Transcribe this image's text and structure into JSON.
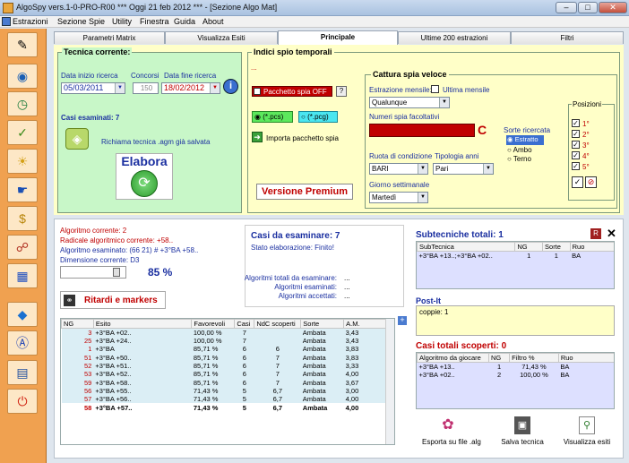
{
  "window": {
    "title": "AlgoSpy vers.1-0-PRO-R00  ***  Oggi 21 feb 2012  ***  - [Sezione Algo Mat]",
    "min": "–",
    "max": "□",
    "close": "✕"
  },
  "menu": [
    "Estrazioni",
    "Sezione Spie",
    "Utility",
    "Finestra",
    "Guida",
    "About"
  ],
  "tabs": [
    "Parametri Matrix",
    "Visualizza Esiti",
    "Principale",
    "Ultime 200 estrazioni",
    "Filtri"
  ],
  "tecnica": {
    "legend": "Tecnica corrente:",
    "data_inizio_label": "Data inizio ricerca",
    "concorsi_label": "Concorsi",
    "data_fine_label": "Data fine ricerca",
    "data_inizio": "05/03/2011",
    "concorsi": "150",
    "data_fine": "18/02/2012",
    "casi_esaminati": "Casi esaminati: 7",
    "richiama": "Richiama tecnica .agm già salvata",
    "elabora": "Elabora"
  },
  "indici": {
    "legend": "Indici spio temporali",
    "dots": "...",
    "pacchetto": "Pacchetto spia OFF",
    "help": "?",
    "pcs": "(*.pcs)",
    "pcg": "(*.pcg)",
    "importa": "Importa pacchetto spia",
    "premium": "Versione Premium"
  },
  "cattura": {
    "legend": "Cattura spia veloce",
    "estrazione_label": "Estrazione mensile:",
    "ultima_label": "Ultima mensile",
    "estrazione_value": "Qualunque",
    "numeri_label": "Numeri spia facoltativi",
    "c_label": "C",
    "sorte_label": "Sorte ricercata",
    "sorte_options": [
      "Estratto",
      "Ambo",
      "Terno"
    ],
    "ruota_label": "Ruota di condizione",
    "ruota_value": "BARI",
    "tipologia_label": "Tipologia anni",
    "tipologia_value": "Pari",
    "giorno_label": "Giorno settimanale",
    "giorno_value": "Martedì",
    "posizioni_label": "Posizioni",
    "posizioni": [
      "1°",
      "2°",
      "3°",
      "4°",
      "5°"
    ]
  },
  "algo": {
    "corrente": "Algoritmo corrente: 2",
    "radicale": "Radicale algoritmico corrente:  +58..",
    "esaminato": "Algoritmo esaminato:  (66 21) # +3°BA +58..",
    "dimensione": "Dimensione corrente:  D3",
    "percent": "85 %",
    "ritardi": "Ritardi e markers"
  },
  "casi": {
    "title": "Casi da esaminare: 7",
    "stato": "Stato elaborazione: Finito!",
    "totali": "Algoritmi totali da esaminare:",
    "esaminati": "Algoritmi esaminati:",
    "accettati": "Algoritmi accettati:",
    "dots": "..."
  },
  "main_table": {
    "headers": [
      "NG",
      "Esito",
      "Favorevoli",
      "Casi",
      "NdC scoperti",
      "Sorte",
      "A.M."
    ],
    "rows": [
      [
        "3",
        "+3°BA +02..",
        "100,00 %",
        "7",
        "",
        "Ambata",
        "3,43"
      ],
      [
        "25",
        "+3°BA +24..",
        "100,00 %",
        "7",
        "",
        "Ambata",
        "3,43"
      ],
      [
        "1",
        "+3°BA",
        "85,71 %",
        "6",
        "6",
        "Ambata",
        "3,83"
      ],
      [
        "51",
        "+3°BA +50..",
        "85,71 %",
        "6",
        "7",
        "Ambata",
        "3,83"
      ],
      [
        "52",
        "+3°BA +51..",
        "85,71 %",
        "6",
        "7",
        "Ambata",
        "3,33"
      ],
      [
        "53",
        "+3°BA +52..",
        "85,71 %",
        "6",
        "7",
        "Ambata",
        "4,00"
      ],
      [
        "59",
        "+3°BA +58..",
        "85,71 %",
        "6",
        "7",
        "Ambata",
        "3,67"
      ],
      [
        "56",
        "+3°BA +55..",
        "71,43 %",
        "5",
        "6,7",
        "Ambata",
        "3,00"
      ],
      [
        "57",
        "+3°BA +56..",
        "71,43 %",
        "5",
        "6,7",
        "Ambata",
        "4,00"
      ],
      [
        "58",
        "+3°BA +57..",
        "71,43 %",
        "5",
        "6,7",
        "Ambata",
        "4,00"
      ]
    ]
  },
  "subtecniche": {
    "title": "Subtecniche totali:  1",
    "headers": [
      "SubTecnica",
      "NG",
      "Sorte",
      "Ruo"
    ],
    "rows": [
      [
        "+3°BA +13..;+3°BA +02..",
        "1",
        "1",
        "BA"
      ]
    ],
    "r_btn": "R",
    "x_btn": "✕"
  },
  "postit": {
    "title": "Post-It",
    "text": "coppie: 1"
  },
  "casi_scoperti": {
    "title": "Casi totali scoperti:  0",
    "headers": [
      "Algoritmo da giocare",
      "NG",
      "Filtro %",
      "Ruo"
    ],
    "rows": [
      [
        "+3°BA +13..",
        "1",
        "71,43 %",
        "BA"
      ],
      [
        "+3°BA +02..",
        "2",
        "100,00 %",
        "BA"
      ]
    ]
  },
  "bottom_buttons": [
    "Esporta su file .alg",
    "Salva tecnica",
    "Visualizza esiti"
  ],
  "colors": {
    "orange": "#f0a150",
    "yellow": "#ffffc8",
    "green": "#c8f7c8",
    "red": "#c00000"
  }
}
